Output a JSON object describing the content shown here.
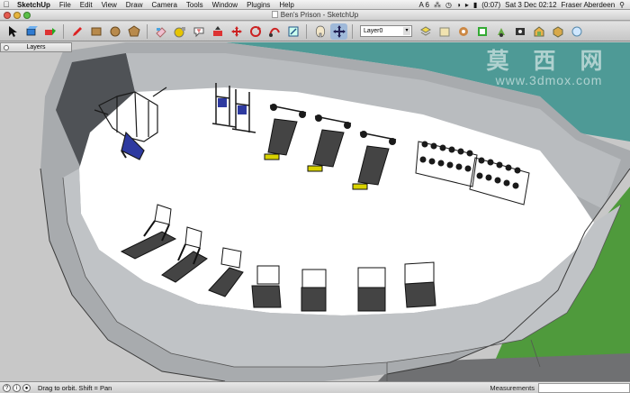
{
  "menubar": {
    "apple": "",
    "items": [
      "SketchUp",
      "File",
      "Edit",
      "View",
      "Draw",
      "Camera",
      "Tools",
      "Window",
      "Plugins",
      "Help"
    ],
    "status_items": [
      "A 6",
      "(0:07)",
      "Sat 3 Dec  02:12",
      "Fraser Aberdeen"
    ]
  },
  "window": {
    "title": "Ben's Prison - SketchUp"
  },
  "toolbar": {
    "layer_value": "Layer0",
    "tools": [
      "select-icon",
      "make-component-icon",
      "paint-bucket-icon",
      "pencil-icon",
      "rectangle-icon",
      "circle-icon",
      "polygon-icon",
      "eraser-icon",
      "tape-measure-icon",
      "text-icon",
      "push-pull-icon",
      "move-icon",
      "rotate-icon",
      "follow-me-icon",
      "scale-icon",
      "orbit-icon",
      "pan-icon"
    ],
    "right_tools": [
      "layers-icon",
      "materials-icon",
      "components-icon",
      "styles-icon",
      "shadows-icon",
      "scenes-icon",
      "get-models-icon",
      "share-model-icon",
      "extension-icon"
    ]
  },
  "palette": {
    "title": "Layers"
  },
  "watermark": {
    "big": "莫 西 网",
    "url": "www.3dmox.com"
  },
  "status": {
    "hint": "Drag to orbit.  Shift = Pan",
    "measurements_label": "Measurements",
    "measurements_value": ""
  },
  "colors": {
    "floor": "#ffffff",
    "wall": "#bdc0c3",
    "wall_top": "#a9acaf",
    "water": "#4e9a96",
    "grass": "#4f9a3c",
    "ground": "#cacaca"
  }
}
